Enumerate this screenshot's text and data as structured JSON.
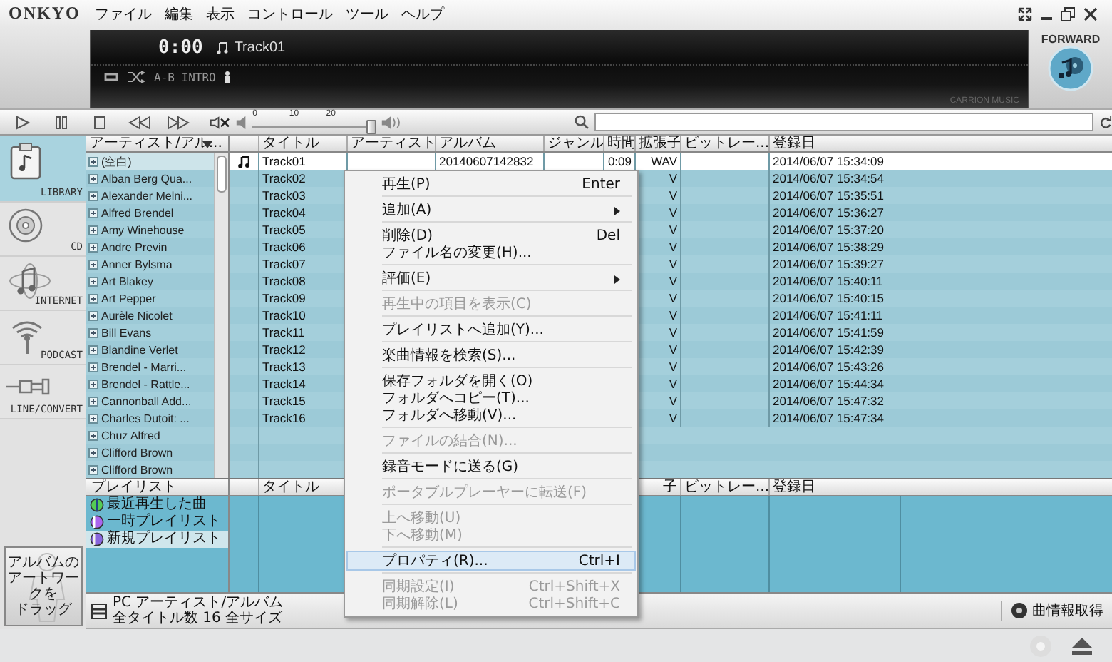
{
  "window": {
    "logo": "ONKYO",
    "menu": [
      "ファイル",
      "編集",
      "表示",
      "コントロール",
      "ツール",
      "ヘルプ"
    ]
  },
  "display": {
    "time": "0:00",
    "track": "Track01",
    "mode_label": "A-B INTRO",
    "brand": "CARRION MUSIC"
  },
  "badge": "FORWARD",
  "volume": {
    "level": 0.97,
    "scale": [
      "0",
      "10",
      "20"
    ]
  },
  "sources": [
    {
      "label": "LIBRARY",
      "kind": "library",
      "selected": true
    },
    {
      "label": "CD",
      "kind": "cd",
      "selected": false
    },
    {
      "label": "INTERNET",
      "kind": "internet",
      "selected": false
    },
    {
      "label": "PODCAST",
      "kind": "podcast",
      "selected": false
    },
    {
      "label": "LINE/CONVERT",
      "kind": "line",
      "selected": false
    }
  ],
  "artists": {
    "header": "アーティスト/アル...",
    "items": [
      {
        "name": "(空白)",
        "selected": true
      },
      {
        "name": "Alban Berg Qua...",
        "selected": false
      },
      {
        "name": "Alexander Melni...",
        "selected": false
      },
      {
        "name": "Alfred Brendel",
        "selected": false
      },
      {
        "name": "Amy Winehouse",
        "selected": false
      },
      {
        "name": "Andre Previn",
        "selected": false
      },
      {
        "name": "Anner Bylsma",
        "selected": false
      },
      {
        "name": "Art Blakey",
        "selected": false
      },
      {
        "name": "Art Pepper",
        "selected": false
      },
      {
        "name": "Aurèle Nicolet",
        "selected": false
      },
      {
        "name": "Bill Evans",
        "selected": false
      },
      {
        "name": "Blandine Verlet",
        "selected": false
      },
      {
        "name": "Brendel - Marri...",
        "selected": false
      },
      {
        "name": "Brendel - Rattle...",
        "selected": false
      },
      {
        "name": "Cannonball Add...",
        "selected": false
      },
      {
        "name": "Charles Dutoit: ...",
        "selected": false
      },
      {
        "name": "Chuz Alfred",
        "selected": false
      },
      {
        "name": "Clifford Brown",
        "selected": false
      },
      {
        "name": "Clifford Brown",
        "selected": false
      }
    ]
  },
  "tracks": {
    "columns": [
      "タイトル",
      "アーティスト",
      "アルバム",
      "ジャンル",
      "時間",
      "拡張子",
      "ビットレー...",
      "登録日"
    ],
    "rows": [
      {
        "title": "Track01",
        "album": "20140607142832",
        "time": "0:09",
        "ext": "WAV",
        "date": "2014/06/07 15:34:09",
        "selected": true,
        "playing": true
      },
      {
        "title": "Track02",
        "ext": "V",
        "date": "2014/06/07 15:34:54",
        "selected": false,
        "playing": false
      },
      {
        "title": "Track03",
        "ext": "V",
        "date": "2014/06/07 15:35:51",
        "selected": false,
        "playing": false
      },
      {
        "title": "Track04",
        "ext": "V",
        "date": "2014/06/07 15:36:27",
        "selected": false,
        "playing": false
      },
      {
        "title": "Track05",
        "ext": "V",
        "date": "2014/06/07 15:37:20",
        "selected": false,
        "playing": false
      },
      {
        "title": "Track06",
        "ext": "V",
        "date": "2014/06/07 15:38:29",
        "selected": false,
        "playing": false
      },
      {
        "title": "Track07",
        "ext": "V",
        "date": "2014/06/07 15:39:27",
        "selected": false,
        "playing": false
      },
      {
        "title": "Track08",
        "ext": "V",
        "date": "2014/06/07 15:40:11",
        "selected": false,
        "playing": false
      },
      {
        "title": "Track09",
        "ext": "V",
        "date": "2014/06/07 15:40:15",
        "selected": false,
        "playing": false
      },
      {
        "title": "Track10",
        "ext": "V",
        "date": "2014/06/07 15:41:11",
        "selected": false,
        "playing": false
      },
      {
        "title": "Track11",
        "ext": "V",
        "date": "2014/06/07 15:41:59",
        "selected": false,
        "playing": false
      },
      {
        "title": "Track12",
        "ext": "V",
        "date": "2014/06/07 15:42:39",
        "selected": false,
        "playing": false
      },
      {
        "title": "Track13",
        "ext": "V",
        "date": "2014/06/07 15:43:26",
        "selected": false,
        "playing": false
      },
      {
        "title": "Track14",
        "ext": "V",
        "date": "2014/06/07 15:44:34",
        "selected": false,
        "playing": false
      },
      {
        "title": "Track15",
        "ext": "V",
        "date": "2014/06/07 15:47:32",
        "selected": false,
        "playing": false
      },
      {
        "title": "Track16",
        "ext": "V",
        "date": "2014/06/07 15:47:34",
        "selected": false,
        "playing": false
      }
    ]
  },
  "playlists": {
    "header": "プレイリスト",
    "items": [
      {
        "name": "最近再生した曲",
        "kind": "recent",
        "selected": false
      },
      {
        "name": "一時プレイリスト",
        "kind": "temporary",
        "selected": false
      },
      {
        "name": "新規プレイリスト",
        "kind": "playlist",
        "selected": true
      }
    ]
  },
  "playlist_tracks": {
    "title": "タイトル",
    "ext_tail": "子",
    "bitrate": "ビットレー...",
    "date": "登録日"
  },
  "artwork_drop": [
    "アルバムの",
    "アートワークを",
    "ドラッグ"
  ],
  "status_bar": {
    "view": "PC アーティスト/アルバム",
    "counts": "全タイトル数 16 全サイズ",
    "info_button": "曲情報取得"
  },
  "context_menu": [
    {
      "kind": "item",
      "label": "再生(P)",
      "shortcut": "Enter",
      "submenu": false,
      "disabled": false,
      "selected": false
    },
    {
      "kind": "separator"
    },
    {
      "kind": "item",
      "label": "追加(A)",
      "submenu": true,
      "disabled": false,
      "selected": false
    },
    {
      "kind": "separator"
    },
    {
      "kind": "item",
      "label": "削除(D)",
      "shortcut": "Del",
      "submenu": false,
      "disabled": false,
      "selected": false
    },
    {
      "kind": "item",
      "label": "ファイル名の変更(H)...",
      "submenu": false,
      "disabled": false,
      "selected": false
    },
    {
      "kind": "separator"
    },
    {
      "kind": "item",
      "label": "評価(E)",
      "submenu": true,
      "disabled": false,
      "selected": false
    },
    {
      "kind": "separator"
    },
    {
      "kind": "item",
      "label": "再生中の項目を表示(C)",
      "submenu": false,
      "disabled": true,
      "selected": false
    },
    {
      "kind": "separator"
    },
    {
      "kind": "item",
      "label": "プレイリストへ追加(Y)...",
      "submenu": false,
      "disabled": false,
      "selected": false
    },
    {
      "kind": "separator"
    },
    {
      "kind": "item",
      "label": "楽曲情報を検索(S)...",
      "submenu": false,
      "disabled": false,
      "selected": false
    },
    {
      "kind": "separator"
    },
    {
      "kind": "item",
      "label": "保存フォルダを開く(O)",
      "submenu": false,
      "disabled": false,
      "selected": false
    },
    {
      "kind": "item",
      "label": "フォルダへコピー(T)...",
      "submenu": false,
      "disabled": false,
      "selected": false
    },
    {
      "kind": "item",
      "label": "フォルダへ移動(V)...",
      "submenu": false,
      "disabled": false,
      "selected": false
    },
    {
      "kind": "separator"
    },
    {
      "kind": "item",
      "label": "ファイルの結合(N)...",
      "submenu": false,
      "disabled": true,
      "selected": false
    },
    {
      "kind": "separator"
    },
    {
      "kind": "item",
      "label": "録音モードに送る(G)",
      "submenu": false,
      "disabled": false,
      "selected": false
    },
    {
      "kind": "separator"
    },
    {
      "kind": "item",
      "label": "ポータブルプレーヤーに転送(F)",
      "submenu": false,
      "disabled": true,
      "selected": false
    },
    {
      "kind": "separator"
    },
    {
      "kind": "item",
      "label": "上へ移動(U)",
      "submenu": false,
      "disabled": true,
      "selected": false
    },
    {
      "kind": "item",
      "label": "下へ移動(M)",
      "submenu": false,
      "disabled": true,
      "selected": false
    },
    {
      "kind": "separator"
    },
    {
      "kind": "item",
      "label": "プロパティ(R)...",
      "shortcut": "Ctrl+I",
      "submenu": false,
      "disabled": false,
      "selected": true
    },
    {
      "kind": "separator"
    },
    {
      "kind": "item",
      "label": "同期設定(I)",
      "shortcut": "Ctrl+Shift+X",
      "submenu": false,
      "disabled": true,
      "selected": false
    },
    {
      "kind": "item",
      "label": "同期解除(L)",
      "shortcut": "Ctrl+Shift+C",
      "submenu": false,
      "disabled": true,
      "selected": false
    }
  ]
}
